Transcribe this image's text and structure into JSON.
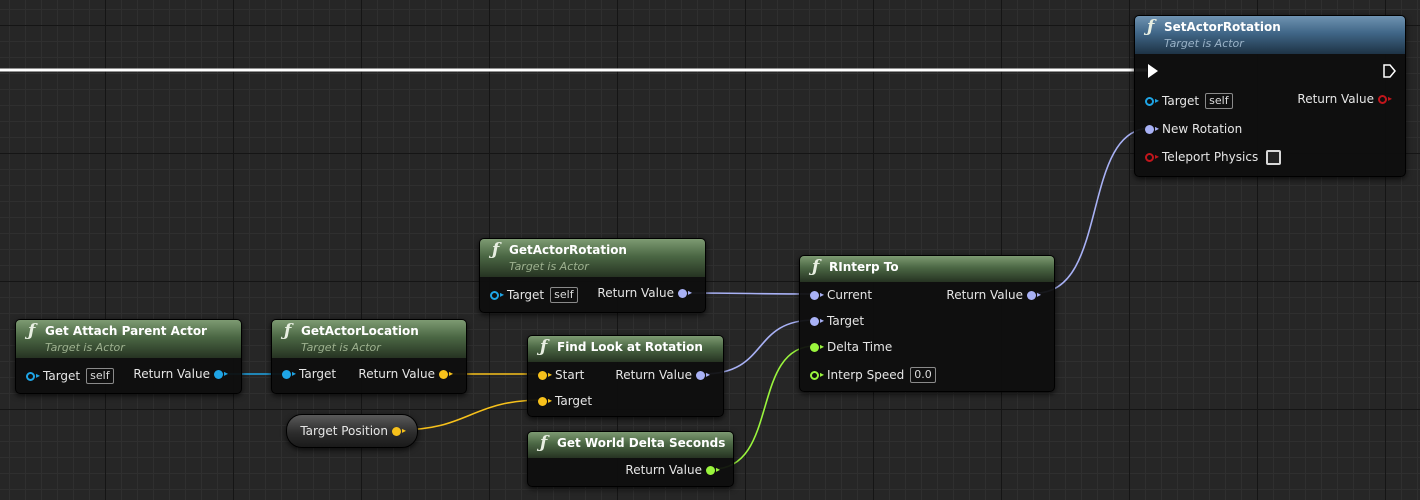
{
  "colors": {
    "exec": "#ffffff",
    "object": "#1fa5e6",
    "vector": "#f7c11b",
    "rotator": "#a8b1f5",
    "float": "#9af53d",
    "bool": "#c2161c",
    "function_header": "#4b6744",
    "target_header": "#406687"
  },
  "nodes": {
    "set_actor_rotation": {
      "title": "SetActorRotation",
      "subtitle": "Target is Actor",
      "icon": "function-icon",
      "pins": {
        "target_label": "Target",
        "target_default": "self",
        "return_label": "Return Value",
        "new_rotation_label": "New Rotation",
        "teleport_label": "Teleport Physics"
      }
    },
    "get_actor_rotation": {
      "title": "GetActorRotation",
      "subtitle": "Target is Actor",
      "pins": {
        "target_label": "Target",
        "target_default": "self",
        "return_label": "Return Value"
      }
    },
    "rinterp_to": {
      "title": "RInterp To",
      "pins": {
        "current_label": "Current",
        "target_label": "Target",
        "delta_label": "Delta Time",
        "speed_label": "Interp Speed",
        "speed_default": "0.0",
        "return_label": "Return Value"
      }
    },
    "get_attach_parent_actor": {
      "title": "Get Attach Parent Actor",
      "subtitle": "Target is Actor",
      "pins": {
        "target_label": "Target",
        "target_default": "self",
        "return_label": "Return Value"
      }
    },
    "get_actor_location": {
      "title": "GetActorLocation",
      "subtitle": "Target is Actor",
      "pins": {
        "target_label": "Target",
        "return_label": "Return Value"
      }
    },
    "find_look_at_rotation": {
      "title": "Find Look at Rotation",
      "pins": {
        "start_label": "Start",
        "target_label": "Target",
        "return_label": "Return Value"
      }
    },
    "target_position": {
      "label": "Target Position"
    },
    "get_world_delta_seconds": {
      "title": "Get World Delta Seconds",
      "pins": {
        "return_label": "Return Value"
      }
    }
  }
}
